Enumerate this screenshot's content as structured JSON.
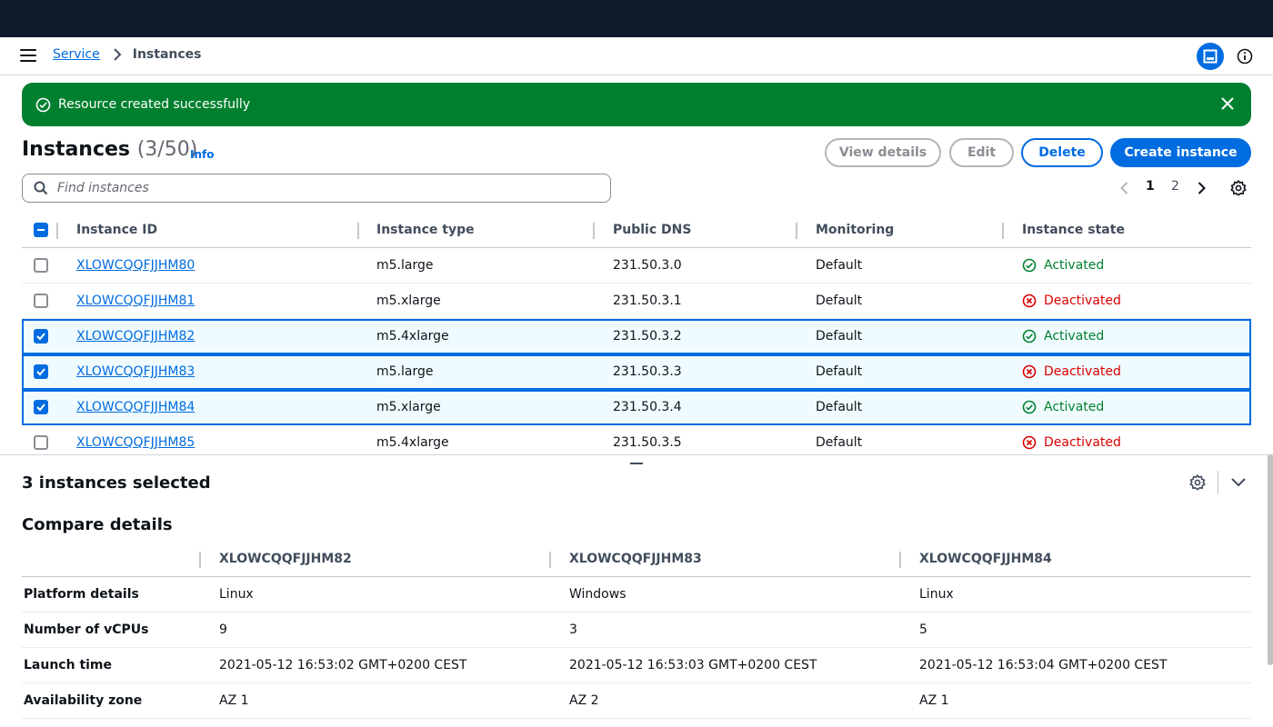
{
  "breadcrumb": {
    "parent": "Service",
    "current": "Instances"
  },
  "flash": {
    "message": "Resource created successfully"
  },
  "header": {
    "title": "Instances",
    "counter": "(3/50)",
    "info": "Info",
    "buttons": {
      "view_details": "View details",
      "edit": "Edit",
      "delete": "Delete",
      "create": "Create instance"
    }
  },
  "search": {
    "placeholder": "Find instances",
    "value": ""
  },
  "pagination": {
    "pages": [
      "1",
      "2"
    ],
    "current": "1"
  },
  "table": {
    "columns": [
      "Instance ID",
      "Instance type",
      "Public DNS",
      "Monitoring",
      "Instance state"
    ],
    "rows": [
      {
        "id": "XLOWCQQFJJHM80",
        "type": "m5.large",
        "dns": "231.50.3.0",
        "monitoring": "Default",
        "state": "Activated",
        "selected": false
      },
      {
        "id": "XLOWCQQFJJHM81",
        "type": "m5.xlarge",
        "dns": "231.50.3.1",
        "monitoring": "Default",
        "state": "Deactivated",
        "selected": false
      },
      {
        "id": "XLOWCQQFJJHM82",
        "type": "m5.4xlarge",
        "dns": "231.50.3.2",
        "monitoring": "Default",
        "state": "Activated",
        "selected": true
      },
      {
        "id": "XLOWCQQFJJHM83",
        "type": "m5.large",
        "dns": "231.50.3.3",
        "monitoring": "Default",
        "state": "Deactivated",
        "selected": true
      },
      {
        "id": "XLOWCQQFJJHM84",
        "type": "m5.xlarge",
        "dns": "231.50.3.4",
        "monitoring": "Default",
        "state": "Activated",
        "selected": true
      },
      {
        "id": "XLOWCQQFJJHM85",
        "type": "m5.4xlarge",
        "dns": "231.50.3.5",
        "monitoring": "Default",
        "state": "Deactivated",
        "selected": false
      }
    ]
  },
  "split_panel": {
    "title": "3 instances selected",
    "compare_title": "Compare details",
    "compare_columns": [
      "XLOWCQQFJJHM82",
      "XLOWCQQFJJHM83",
      "XLOWCQQFJJHM84"
    ],
    "compare_rows": [
      {
        "label": "Platform details",
        "values": [
          "Linux",
          "Windows",
          "Linux"
        ]
      },
      {
        "label": "Number of vCPUs",
        "values": [
          "9",
          "3",
          "5"
        ]
      },
      {
        "label": "Launch time",
        "values": [
          "2021-05-12 16:53:02 GMT+0200 CEST",
          "2021-05-12 16:53:03 GMT+0200 CEST",
          "2021-05-12 16:53:04 GMT+0200 CEST"
        ]
      },
      {
        "label": "Availability zone",
        "values": [
          "AZ 1",
          "AZ 2",
          "AZ 1"
        ]
      }
    ]
  },
  "colors": {
    "primary": "#006ce0",
    "success": "#00802f",
    "error": "#db0000",
    "topbar": "#0f1b2a"
  },
  "icons": [
    "menu-icon",
    "chevron-right-icon",
    "split-panel-icon",
    "info-circle-icon",
    "check-circle-icon",
    "close-icon",
    "search-icon",
    "chevron-left-icon",
    "gear-icon",
    "x-circle-icon",
    "chevron-down-icon"
  ]
}
